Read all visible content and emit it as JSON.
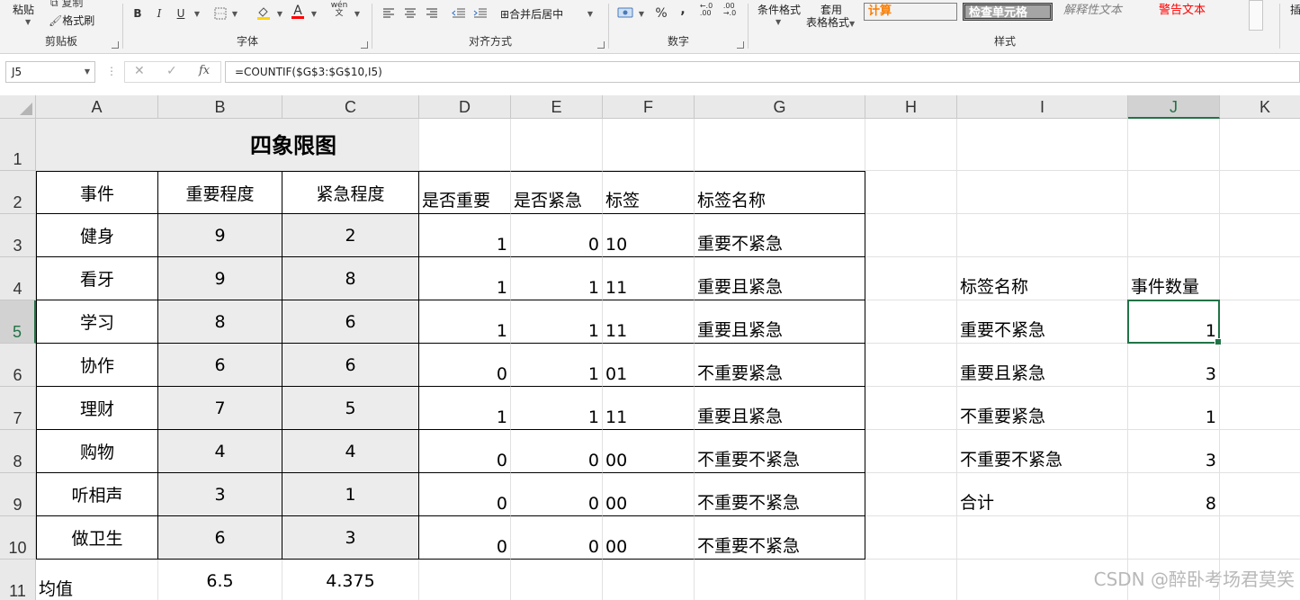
{
  "ribbon": {
    "clipboard": {
      "paste": "粘贴",
      "copy": "复制",
      "format_painter": "格式刷",
      "group": "剪贴板"
    },
    "font": {
      "bold": "B",
      "italic": "I",
      "underline": "U",
      "phonetic": "wén\n文",
      "group": "字体"
    },
    "alignment": {
      "merge_center": "合并后居中",
      "group": "对齐方式"
    },
    "number": {
      "percent": "%",
      "comma": ",",
      "inc_decimal": "←.0\n.00",
      "dec_decimal": ".00\n→.0",
      "group": "数字"
    },
    "styles": {
      "conditional_format": "条件格式",
      "table_format_1": "套用",
      "table_format_2": "表格格式",
      "calc": "计算",
      "check_cell": "检查单元格",
      "explanatory": "解释性文本",
      "warning": "警告文本",
      "group": "样式"
    },
    "right_stub": "插",
    "colors": {
      "calc": "#fa7d00",
      "warning": "#ff0000",
      "check_bg": "#a5a5a5",
      "accent": "#217346"
    }
  },
  "formula_bar": {
    "name_box": "J5",
    "cancel_icon": "✕",
    "enter_icon": "✓",
    "fx": "fx",
    "formula": "=COUNTIF($G$3:$G$10,I5)"
  },
  "columns": [
    "A",
    "B",
    "C",
    "D",
    "E",
    "F",
    "G",
    "H",
    "I",
    "J",
    "K"
  ],
  "rows": [
    "1",
    "2",
    "3",
    "4",
    "5",
    "6",
    "7",
    "8",
    "9",
    "10",
    "11"
  ],
  "sheet": {
    "title": "四象限图",
    "headers": {
      "event": "事件",
      "importance": "重要程度",
      "urgency": "紧急程度",
      "is_important": "是否重要",
      "is_urgent": "是否紧急",
      "tag": "标签",
      "tag_name": "标签名称"
    },
    "records": [
      {
        "event": "健身",
        "importance": "9",
        "urgency": "2",
        "is_important": "1",
        "is_urgent": "0",
        "tag": "10",
        "tag_name": "重要不紧急"
      },
      {
        "event": "看牙",
        "importance": "9",
        "urgency": "8",
        "is_important": "1",
        "is_urgent": "1",
        "tag": "11",
        "tag_name": "重要且紧急"
      },
      {
        "event": "学习",
        "importance": "8",
        "urgency": "6",
        "is_important": "1",
        "is_urgent": "1",
        "tag": "11",
        "tag_name": "重要且紧急"
      },
      {
        "event": "协作",
        "importance": "6",
        "urgency": "6",
        "is_important": "0",
        "is_urgent": "1",
        "tag": "01",
        "tag_name": "不重要紧急"
      },
      {
        "event": "理财",
        "importance": "7",
        "urgency": "5",
        "is_important": "1",
        "is_urgent": "1",
        "tag": "11",
        "tag_name": "重要且紧急"
      },
      {
        "event": "购物",
        "importance": "4",
        "urgency": "4",
        "is_important": "0",
        "is_urgent": "0",
        "tag": "00",
        "tag_name": "不重要不紧急"
      },
      {
        "event": "听相声",
        "importance": "3",
        "urgency": "1",
        "is_important": "0",
        "is_urgent": "0",
        "tag": "00",
        "tag_name": "不重要不紧急"
      },
      {
        "event": "做卫生",
        "importance": "6",
        "urgency": "3",
        "is_important": "0",
        "is_urgent": "0",
        "tag": "00",
        "tag_name": "不重要不紧急"
      }
    ],
    "average": {
      "label": "均值",
      "importance": "6.5",
      "urgency": "4.375"
    },
    "summary": {
      "header_name": "标签名称",
      "header_count": "事件数量",
      "items": [
        {
          "name": "重要不紧急",
          "count": "1"
        },
        {
          "name": "重要且紧急",
          "count": "3"
        },
        {
          "name": "不重要紧急",
          "count": "1"
        },
        {
          "name": "不重要不紧急",
          "count": "3"
        },
        {
          "name": "合计",
          "count": "8"
        }
      ]
    }
  },
  "watermark": "CSDN @醉卧考场君莫笑"
}
